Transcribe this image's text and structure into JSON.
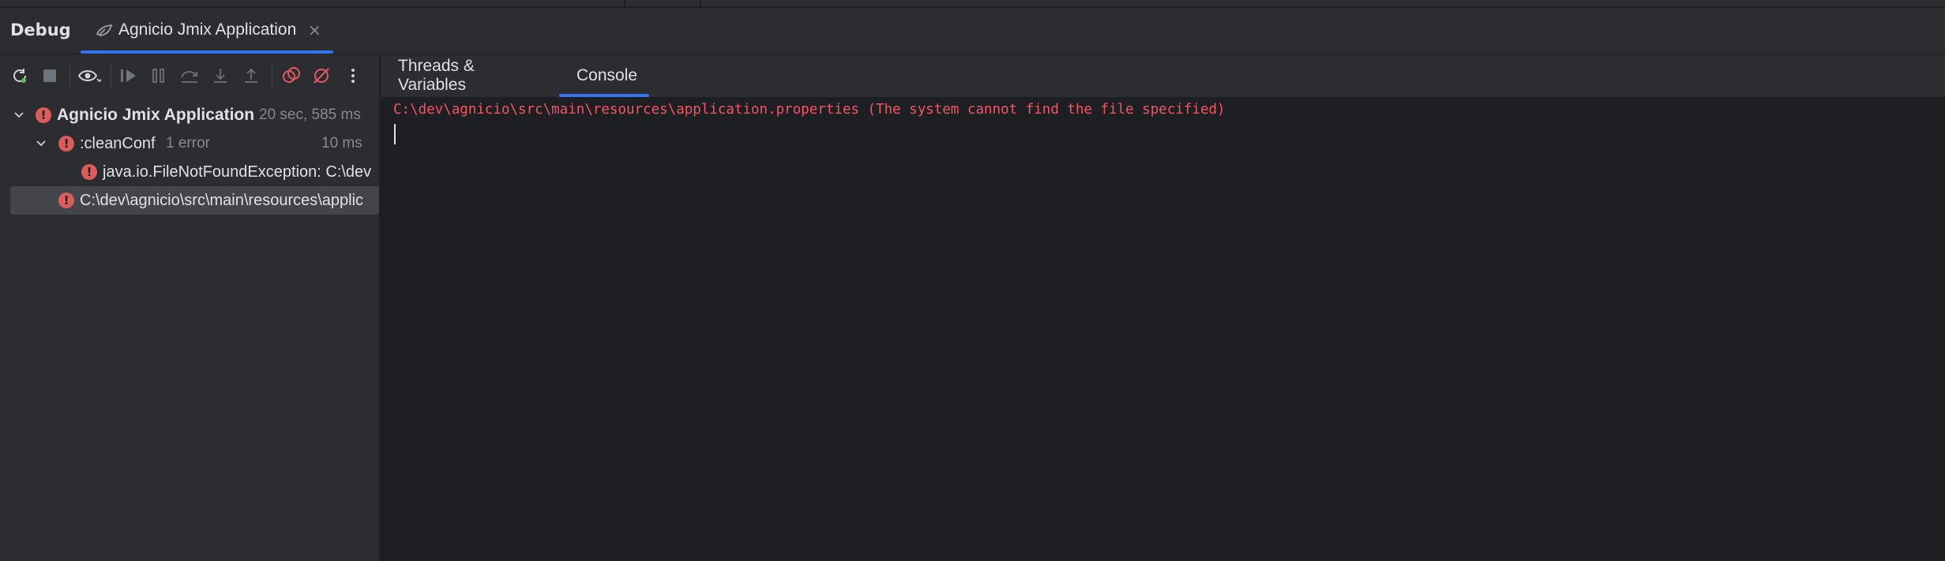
{
  "header": {
    "title": "Debug",
    "run_tab": {
      "label": "Agnicio Jmix Application",
      "close": "×"
    }
  },
  "toolbar": {
    "buttons": [
      "rerun-icon",
      "stop-icon",
      "view-icon",
      "resume-icon",
      "pause-icon",
      "step-over-icon",
      "step-into-icon",
      "step-out-icon",
      "view-breakpoints-icon",
      "mute-breakpoints-icon",
      "more-icon"
    ]
  },
  "right_tabs": [
    {
      "label": "Threads & Variables",
      "active": false
    },
    {
      "label": "Console",
      "active": true
    }
  ],
  "tree": {
    "root": {
      "label": "Agnicio Jmix Application",
      "meta": "20 sec, 585 ms"
    },
    "task": {
      "label": ":cleanConf",
      "meta": "1 error",
      "time": "10 ms"
    },
    "exception": {
      "label": "java.io.FileNotFoundException: C:\\dev"
    },
    "path": {
      "label": "C:\\dev\\agnicio\\src\\main\\resources\\applic"
    }
  },
  "console": {
    "line": "C:\\dev\\agnicio\\src\\main\\resources\\application.properties (The system cannot find the file specified)"
  },
  "colors": {
    "accent": "#3574f0",
    "error": "#db5c5c",
    "console_error": "#f75464",
    "panel_bg": "#2b2d30",
    "editor_bg": "#1e1f22"
  }
}
